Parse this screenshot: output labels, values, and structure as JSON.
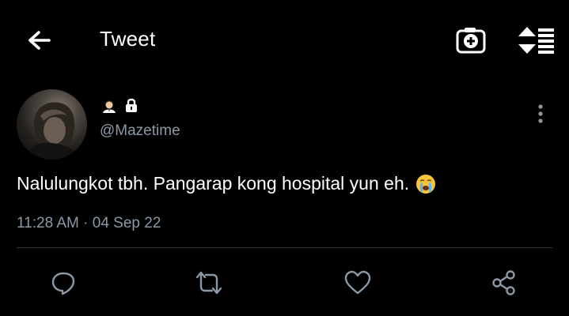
{
  "header": {
    "title": "Tweet",
    "back_icon": "arrow-left-icon",
    "camera_icon": "camera-plus-icon",
    "sort_icon": "sort-list-icon"
  },
  "tweet": {
    "handle": "@Mazetime",
    "text": "Nalulungkot tbh. Pangarap kong hospital yun eh.",
    "timestamp": "11:28 AM · 04 Sep 22",
    "name_icons": [
      "person-emoji-icon",
      "lock-icon"
    ],
    "text_emoji": "crying-face-emoji-icon"
  },
  "actions": [
    "reply-icon",
    "retweet-icon",
    "like-icon",
    "share-icon"
  ],
  "colors": {
    "background": "#000000",
    "text": "#ffffff",
    "secondary_text": "#8b98a5",
    "divider": "#2f3336"
  }
}
